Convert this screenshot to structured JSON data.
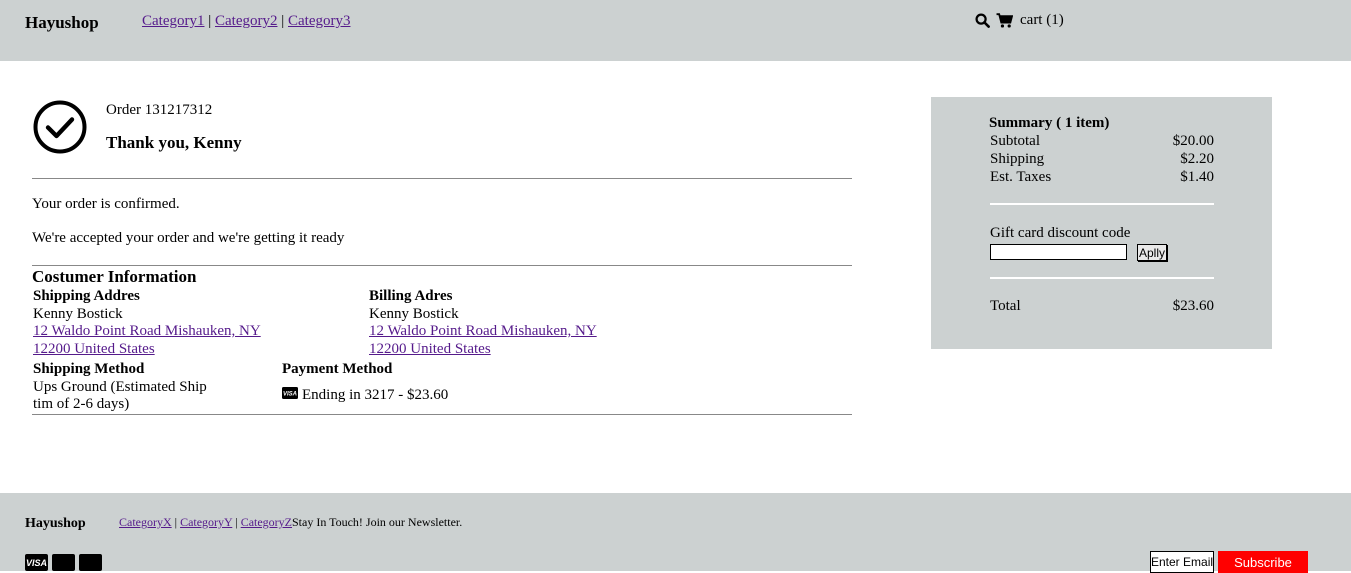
{
  "header": {
    "brand": "Hayushop",
    "nav": [
      {
        "label": "Category1"
      },
      {
        "label": "Category2"
      },
      {
        "label": "Category3"
      }
    ],
    "separator": "|",
    "cart_label": "cart (1)",
    "icons": [
      "search-icon",
      "cart-icon"
    ]
  },
  "order": {
    "number_text": "Order 131217312",
    "thank_you": "Thank you, Kenny",
    "confirmed_text": "Your order is confirmed.",
    "accepted_text": "We're accepted your order and we're getting it ready"
  },
  "customer": {
    "title": "Costumer Information",
    "shipping_address": {
      "label": "Shipping Addres",
      "name": "Kenny Bostick",
      "line1": "12 Waldo Point Road Mishauken, NY",
      "line2": "12200 United States"
    },
    "billing_address": {
      "label": "Billing Adres",
      "name": "Kenny Bostick",
      "line1": "12 Waldo Point Road Mishauken, NY",
      "line2": "12200 United States"
    },
    "shipping_method": {
      "label": "Shipping Method",
      "line1": "Ups Ground (Estimated Ship",
      "line2": "tim of 2-6 days)"
    },
    "payment_method": {
      "label": "Payment Method",
      "card_icon": "visa-card-icon",
      "text": "Ending in 3217 - $23.60"
    }
  },
  "summary": {
    "title": "Summary ( 1 item)",
    "rows": [
      {
        "label": "Subtotal",
        "value": "$20.00"
      },
      {
        "label": "Shipping",
        "value": "$2.20"
      },
      {
        "label": "Est. Taxes",
        "value": "$1.40"
      }
    ],
    "gift_label": "Gift card discount code",
    "gift_value": "",
    "apply_label": "Aplly",
    "total_label": "Total",
    "total_value": "$23.60"
  },
  "footer": {
    "brand": "Hayushop",
    "nav": [
      {
        "label": "CategoryX"
      },
      {
        "label": "CategoryY"
      },
      {
        "label": "CategoryZ"
      }
    ],
    "newsletter_text": "Stay In Touch! Join our Newsletter.",
    "cards": [
      {
        "icon": "visa-card-icon",
        "label": "VISA"
      },
      {
        "icon": "card-icon"
      },
      {
        "icon": "card-icon"
      }
    ],
    "email_placeholder": "Enter Email",
    "subscribe_label": "Subscribe"
  },
  "colors": {
    "header_bg": "#ccd1d1",
    "subscribe_bg": "#ff0000",
    "link": "#551a8b"
  }
}
